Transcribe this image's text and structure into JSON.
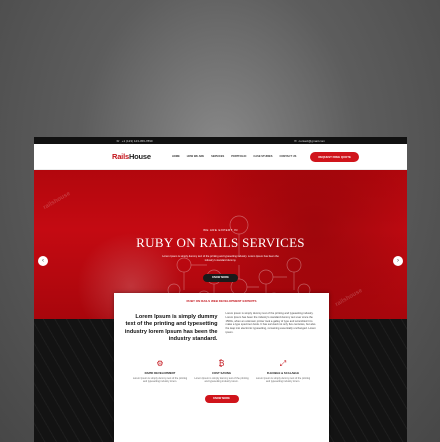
{
  "topbar": {
    "phone": "+1 (123) 123-456-7890",
    "email": "contact@gmail.com"
  },
  "brand": {
    "name_part1": "Rails",
    "name_part2": "House"
  },
  "nav": {
    "items": [
      "HOME",
      "HOW WE ARE",
      "SERVICES",
      "PORTFOLIO",
      "CASE STUDIES",
      "CONTACT US"
    ],
    "quote_label": "REQUEST FREE QUOTE"
  },
  "hero": {
    "kicker": "WE ARE EXPERT IN",
    "title": "RUBY ON RAILS SERVICES",
    "description": "Lorem Ipsum is simply dummy text of the printing and typesetting industry. Lorem Ipsum has been the industry's standard dummy.",
    "button": "KNOW MORE",
    "prev_arrow": "‹",
    "next_arrow": "›",
    "watermark": "railshouse"
  },
  "about": {
    "tag": "RUBY ON RAILS WEB DEVELOPMENT EXPERTS",
    "headline": "Lorem Ipsum is simply dummy text of the printing and typesetting industry lorem Ipsum has been the industry standard.",
    "body": "Lorem ipsum is simply dummy text of the printing and typesetting industry. Lorem Ipsum has been the industry's standard dummy text ever since the 1500s, when an unknown printer took a galley of type and scrambled it to make a type specimen book. It has survived not only five centuries, but also the leap into electronic typesetting, remaining essentially unchanged. Lorem ipsum.",
    "features": [
      {
        "icon": "⚙",
        "title": "RAPID DEVELOPMENT",
        "desc": "Lorem Ipsum is simply dummy text of the printing and typesetting industry lorem."
      },
      {
        "icon": "₿",
        "title": "COST SAVING",
        "desc": "Lorem Ipsum is simply dummy text of the printing and typesetting industry lorem."
      },
      {
        "icon": "⤢",
        "title": "FLEXIBLE & SCALABLE",
        "desc": "Lorem Ipsum is simply dummy text of the printing and typesetting industry lorem."
      }
    ],
    "button": "KNOW MORE"
  },
  "colors": {
    "brand_red": "#d0141b",
    "dark_bg": "#151515"
  }
}
